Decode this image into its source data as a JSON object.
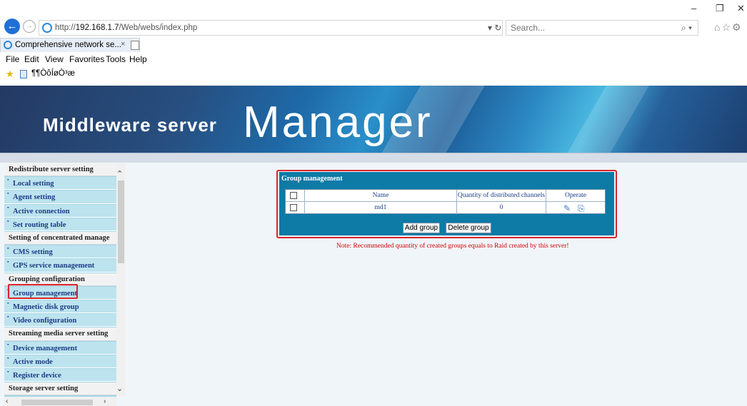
{
  "browser": {
    "url_prefix": "http://",
    "url_host": "192.168.1.7",
    "url_path": "/Web/webs/index.php",
    "search_placeholder": "Search...",
    "tab_title": "Comprehensive network se...",
    "tab_close": "×",
    "menu": [
      "File",
      "Edit",
      "View",
      "Favorites",
      "Tools",
      "Help"
    ],
    "favorite_text": "¶¶ÒôÍøÒ³æ",
    "window_controls": [
      "–",
      "❐",
      "✕"
    ]
  },
  "banner": {
    "small_text": "Middleware server",
    "big_text": "Manager"
  },
  "sidebar": {
    "items": [
      {
        "type": "head",
        "label": "Redistribute server setting"
      },
      {
        "type": "link",
        "label": "Local setting"
      },
      {
        "type": "link",
        "label": "Agent setting"
      },
      {
        "type": "link",
        "label": "Active connection"
      },
      {
        "type": "link",
        "label": "Set routing table"
      },
      {
        "type": "head",
        "label": "Setting of concentrated manage"
      },
      {
        "type": "link",
        "label": "CMS setting"
      },
      {
        "type": "link",
        "label": "GPS service management"
      },
      {
        "type": "head",
        "label": "Grouping configuration"
      },
      {
        "type": "link",
        "label": "Group management",
        "selected": true
      },
      {
        "type": "link",
        "label": "Magnetic disk group"
      },
      {
        "type": "link",
        "label": "Video configuration"
      },
      {
        "type": "head",
        "label": "Streaming media server setting"
      },
      {
        "type": "link",
        "label": "Device management"
      },
      {
        "type": "link",
        "label": "Active mode"
      },
      {
        "type": "link",
        "label": "Register device"
      },
      {
        "type": "head",
        "label": "Storage server setting"
      }
    ]
  },
  "panel": {
    "title": "Group management",
    "columns": [
      "Name",
      "Quantity of distributed channels",
      "Operate"
    ],
    "rows": [
      {
        "name": "md1",
        "channels": "0"
      }
    ],
    "add_label": "Add group",
    "delete_label": "Delete group",
    "note": "Note: Recommended quantity of created groups equals to Raid created by this server!"
  }
}
